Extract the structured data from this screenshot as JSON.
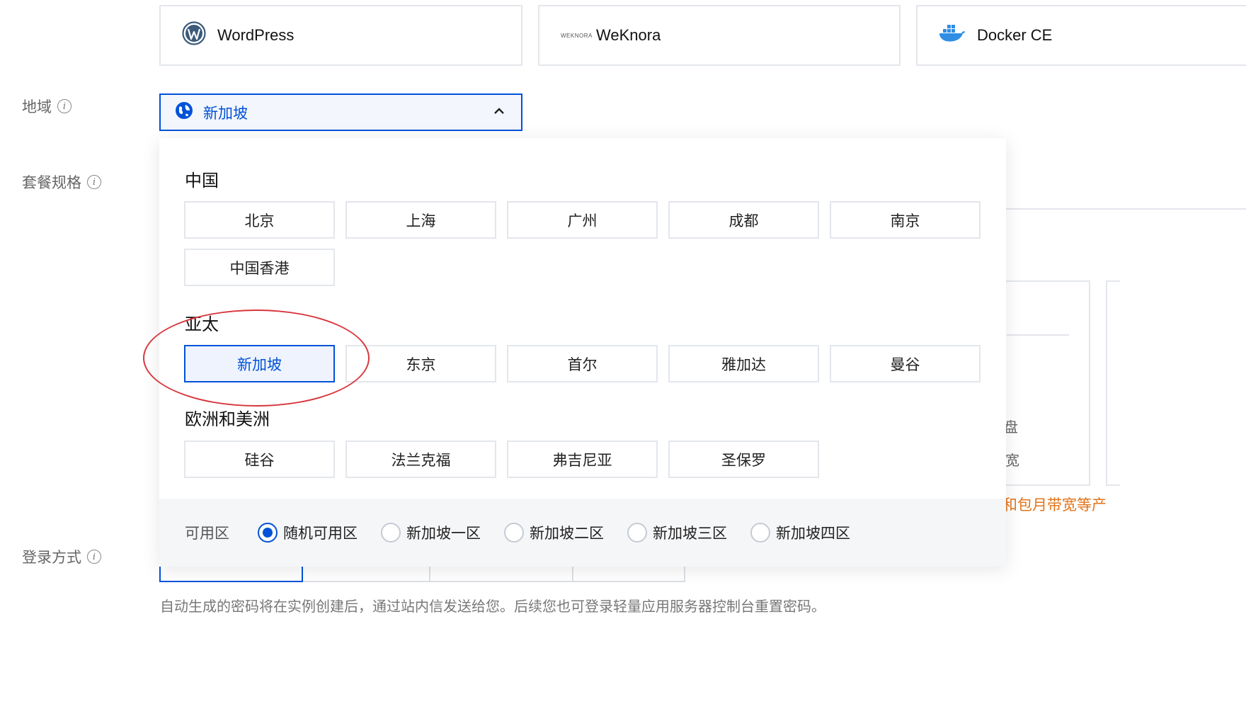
{
  "apps": [
    {
      "label": "WordPress",
      "icon": "wordpress-logo-icon"
    },
    {
      "label": "WeKnora",
      "icon": "weknora-logo-icon",
      "logo_text": "WEKNORA"
    },
    {
      "label": "Docker CE",
      "icon": "docker-logo-icon"
    }
  ],
  "form": {
    "region_label": "地域",
    "plan_label": "套餐规格",
    "login_label": "登录方式"
  },
  "region_select": {
    "value": "新加坡",
    "icon": "globe-icon",
    "expanded": true
  },
  "dropdown": {
    "groups": [
      {
        "title": "中国",
        "items": [
          "北京",
          "上海",
          "广州",
          "成都",
          "南京",
          "中国香港"
        ]
      },
      {
        "title": "亚太",
        "items": [
          "新加坡",
          "东京",
          "首尔",
          "雅加达",
          "曼谷"
        ]
      },
      {
        "title": "欧洲和美洲",
        "items": [
          "硅谷",
          "法兰克福",
          "弗吉尼亚",
          "圣保罗"
        ]
      }
    ],
    "selected": "新加坡",
    "zone": {
      "label": "可用区",
      "options": [
        "随机可用区",
        "新加坡一区",
        "新加坡二区",
        "新加坡三区",
        "新加坡四区"
      ],
      "selected": "随机可用区"
    }
  },
  "login": {
    "hint": "自动生成的密码将在实例创建后，通过站内信发送给您。后续您也可登录轻量应用服务器控制台重置密码。"
  },
  "background_fragments": {
    "orange_text": "和包月带宽等产",
    "frag1": "盘",
    "frag2": "宽"
  },
  "colors": {
    "brand": "#0052d9",
    "annotation": "#d9363e",
    "warning": "#e37318"
  }
}
